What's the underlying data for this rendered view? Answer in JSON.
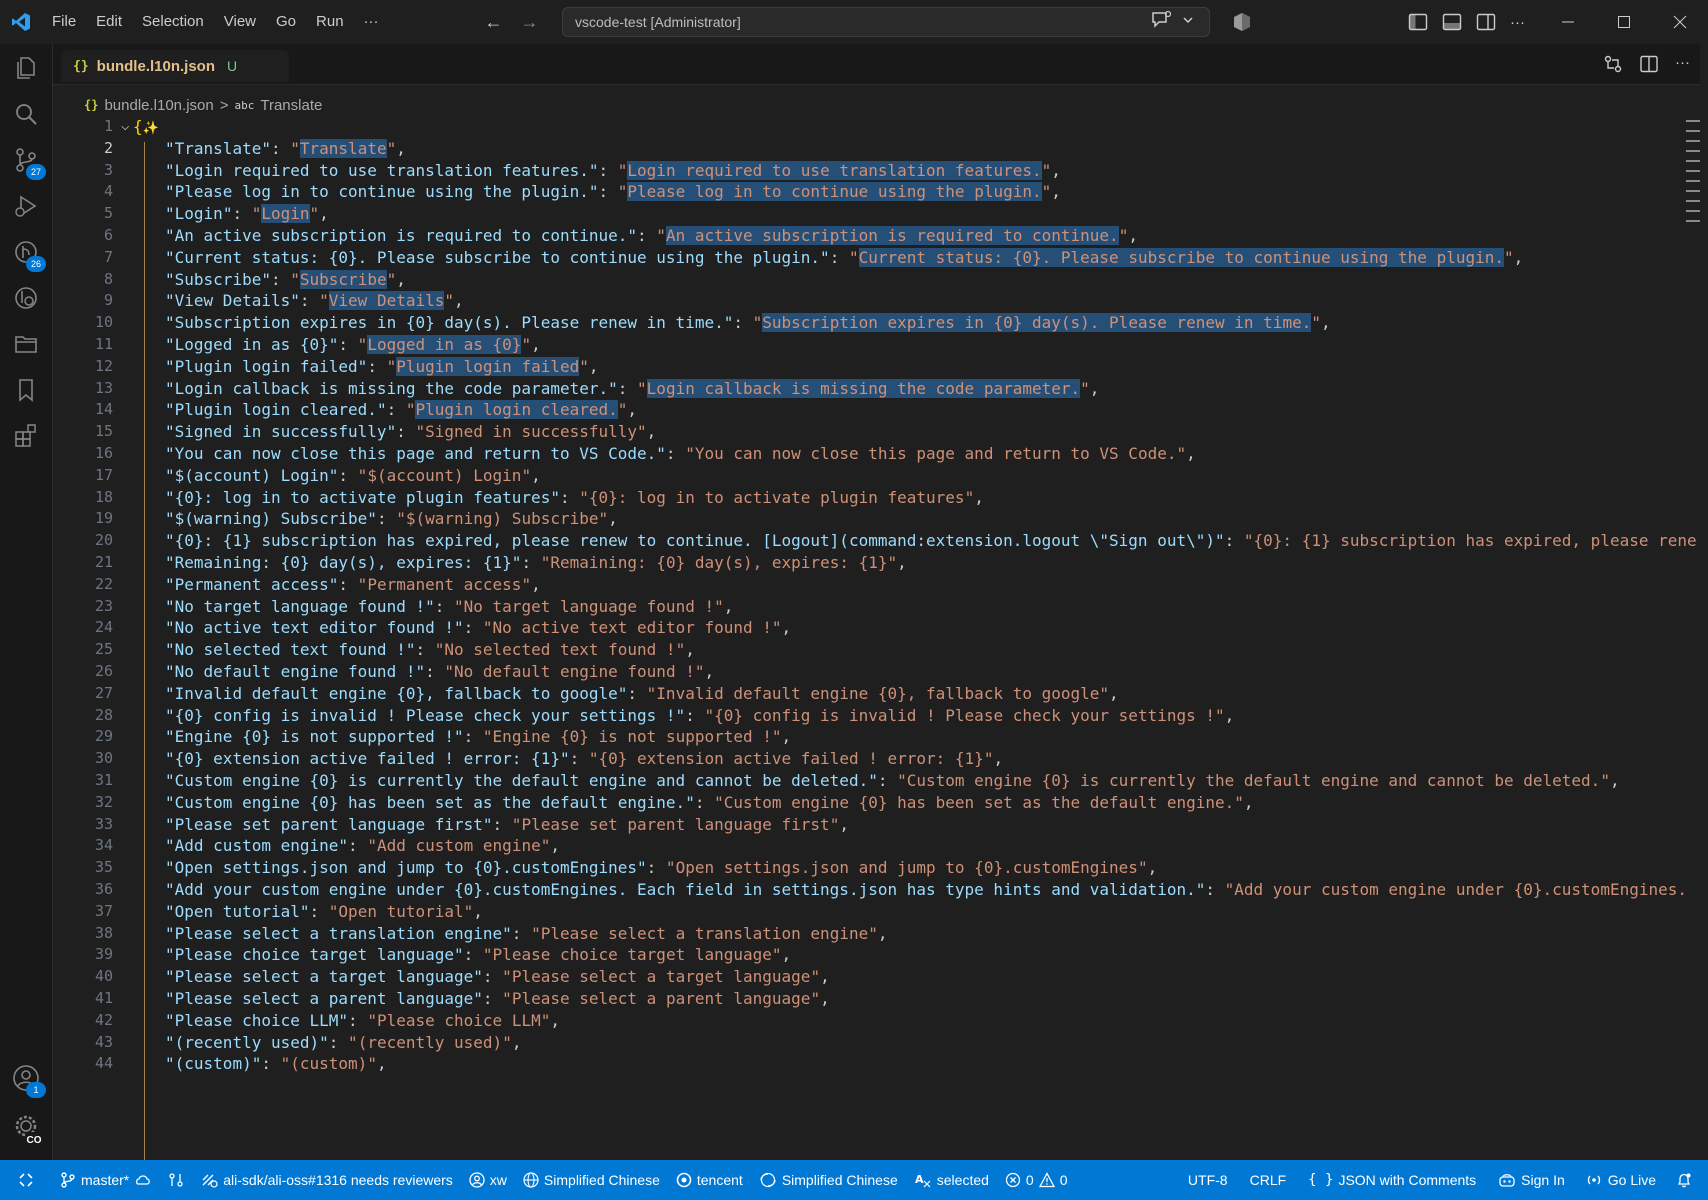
{
  "titlebar": {
    "menu": [
      "File",
      "Edit",
      "Selection",
      "View",
      "Go",
      "Run",
      "···"
    ],
    "command_center": "vscode-test [Administrator]",
    "more": "···"
  },
  "activitybar": {
    "items": [
      {
        "name": "explorer-icon",
        "badge": ""
      },
      {
        "name": "search-icon",
        "badge": ""
      },
      {
        "name": "source-control-icon",
        "badge": "27"
      },
      {
        "name": "run-debug-icon",
        "badge": ""
      },
      {
        "name": "timeline-icon",
        "badge": "26"
      },
      {
        "name": "git-graph-icon",
        "badge": ""
      },
      {
        "name": "folder-icon",
        "badge": ""
      },
      {
        "name": "bookmark-icon",
        "badge": ""
      },
      {
        "name": "extensions-icon",
        "badge": ""
      }
    ],
    "bottom": [
      {
        "name": "account-icon",
        "badge": "1"
      },
      {
        "name": "settings-icon",
        "badge": "CO"
      }
    ]
  },
  "tab": {
    "icon": "{}",
    "label": "bundle.l10n.json",
    "status": "U",
    "more": "···"
  },
  "breadcrumb": {
    "icon": "{}",
    "file": "bundle.l10n.json",
    "sep": ">",
    "symbol_icon": "abc",
    "symbol": "Translate"
  },
  "editor": {
    "current_line": 2,
    "lines": [
      {
        "n": "1",
        "type": "open"
      },
      {
        "n": "2",
        "k": "Translate",
        "v": "Translate",
        "hl": true
      },
      {
        "n": "3",
        "k": "Login required to use translation features.",
        "v": "Login required to use translation features.",
        "hl": true
      },
      {
        "n": "4",
        "k": "Please log in to continue using the plugin.",
        "v": "Please log in to continue using the plugin.",
        "hl": true
      },
      {
        "n": "5",
        "k": "Login",
        "v": "Login",
        "hl": true
      },
      {
        "n": "6",
        "k": "An active subscription is required to continue.",
        "v": "An active subscription is required to continue.",
        "hl": true
      },
      {
        "n": "7",
        "k": "Current status: {0}. Please subscribe to continue using the plugin.",
        "v": "Current status: {0}. Please subscribe to continue using the plugin.",
        "hl": true
      },
      {
        "n": "8",
        "k": "Subscribe",
        "v": "Subscribe",
        "hl": true
      },
      {
        "n": "9",
        "k": "View Details",
        "v": "View Details",
        "hl": true
      },
      {
        "n": "10",
        "k": "Subscription expires in {0} day(s). Please renew in time.",
        "v": "Subscription expires in {0} day(s). Please renew in time.",
        "hl": true
      },
      {
        "n": "11",
        "k": "Logged in as {0}",
        "v": "Logged in as {0}",
        "hl": true
      },
      {
        "n": "12",
        "k": "Plugin login failed",
        "v": "Plugin login failed",
        "hl": true
      },
      {
        "n": "13",
        "k": "Login callback is missing the code parameter.",
        "v": "Login callback is missing the code parameter.",
        "hl": true
      },
      {
        "n": "14",
        "k": "Plugin login cleared.",
        "v": "Plugin login cleared.",
        "hl": true
      },
      {
        "n": "15",
        "k": "Signed in successfully",
        "v": "Signed in successfully",
        "hl": false
      },
      {
        "n": "16",
        "k": "You can now close this page and return to VS Code.",
        "v": "You can now close this page and return to VS Code.",
        "hl": false
      },
      {
        "n": "17",
        "k": "$(account) Login",
        "v": "$(account) Login",
        "hl": false
      },
      {
        "n": "18",
        "k": "{0}: log in to activate plugin features",
        "v": "{0}: log in to activate plugin features",
        "hl": false
      },
      {
        "n": "19",
        "k": "$(warning) Subscribe",
        "v": "$(warning) Subscribe",
        "hl": false
      },
      {
        "n": "20",
        "k": "{0}: {1} subscription has expired, please renew to continue. [Logout](command:extension.logout \\\"Sign out\\\")",
        "v": "{0}: {1} subscription has expired, please rene",
        "hl": false,
        "trunc": true
      },
      {
        "n": "21",
        "k": "Remaining: {0} day(s), expires: {1}",
        "v": "Remaining: {0} day(s), expires: {1}",
        "hl": false
      },
      {
        "n": "22",
        "k": "Permanent access",
        "v": "Permanent access",
        "hl": false
      },
      {
        "n": "23",
        "k": "No target language found !",
        "v": "No target language found !",
        "hl": false
      },
      {
        "n": "24",
        "k": "No active text editor found !",
        "v": "No active text editor found !",
        "hl": false
      },
      {
        "n": "25",
        "k": "No selected text found !",
        "v": "No selected text found !",
        "hl": false
      },
      {
        "n": "26",
        "k": "No default engine found !",
        "v": "No default engine found !",
        "hl": false
      },
      {
        "n": "27",
        "k": "Invalid default engine {0}, fallback to google",
        "v": "Invalid default engine {0}, fallback to google",
        "hl": false
      },
      {
        "n": "28",
        "k": "{0} config is invalid ! Please check your settings !",
        "v": "{0} config is invalid ! Please check your settings !",
        "hl": false
      },
      {
        "n": "29",
        "k": "Engine {0} is not supported !",
        "v": "Engine {0} is not supported !",
        "hl": false
      },
      {
        "n": "30",
        "k": "{0} extension active failed ! error: {1}",
        "v": "{0} extension active failed ! error: {1}",
        "hl": false
      },
      {
        "n": "31",
        "k": "Custom engine {0} is currently the default engine and cannot be deleted.",
        "v": "Custom engine {0} is currently the default engine and cannot be deleted.",
        "hl": false
      },
      {
        "n": "32",
        "k": "Custom engine {0} has been set as the default engine.",
        "v": "Custom engine {0} has been set as the default engine.",
        "hl": false
      },
      {
        "n": "33",
        "k": "Please set parent language first",
        "v": "Please set parent language first",
        "hl": false
      },
      {
        "n": "34",
        "k": "Add custom engine",
        "v": "Add custom engine",
        "hl": false
      },
      {
        "n": "35",
        "k": "Open settings.json and jump to {0}.customEngines",
        "v": "Open settings.json and jump to {0}.customEngines",
        "hl": false
      },
      {
        "n": "36",
        "k": "Add your custom engine under {0}.customEngines. Each field in settings.json has type hints and validation.",
        "v": "Add your custom engine under {0}.customEngines.",
        "hl": false,
        "trunc": true
      },
      {
        "n": "37",
        "k": "Open tutorial",
        "v": "Open tutorial",
        "hl": false
      },
      {
        "n": "38",
        "k": "Please select a translation engine",
        "v": "Please select a translation engine",
        "hl": false
      },
      {
        "n": "39",
        "k": "Please choice target language",
        "v": "Please choice target language",
        "hl": false
      },
      {
        "n": "40",
        "k": "Please select a target language",
        "v": "Please select a target language",
        "hl": false
      },
      {
        "n": "41",
        "k": "Please select a parent language",
        "v": "Please select a parent language",
        "hl": false
      },
      {
        "n": "42",
        "k": "Please choice LLM",
        "v": "Please choice LLM",
        "hl": false
      },
      {
        "n": "43",
        "k": "(recently used)",
        "v": "(recently used)",
        "hl": false
      },
      {
        "n": "44",
        "k": "(custom)",
        "v": "(custom)",
        "hl": false
      }
    ]
  },
  "statusbar": {
    "branch": "master*",
    "pr": "ali-sdk/ali-oss#1316 needs reviewers",
    "user": "xw",
    "lang1": "Simplified Chinese",
    "engine": "tencent",
    "lang2": "Simplified Chinese",
    "selected": "selected",
    "errors": "0",
    "warnings": "0",
    "encoding": "UTF-8",
    "eol": "CRLF",
    "language_mode_icon": "{ }",
    "language_mode": "JSON with Comments",
    "sign_in": "Sign In",
    "go_live": "Go Live"
  }
}
